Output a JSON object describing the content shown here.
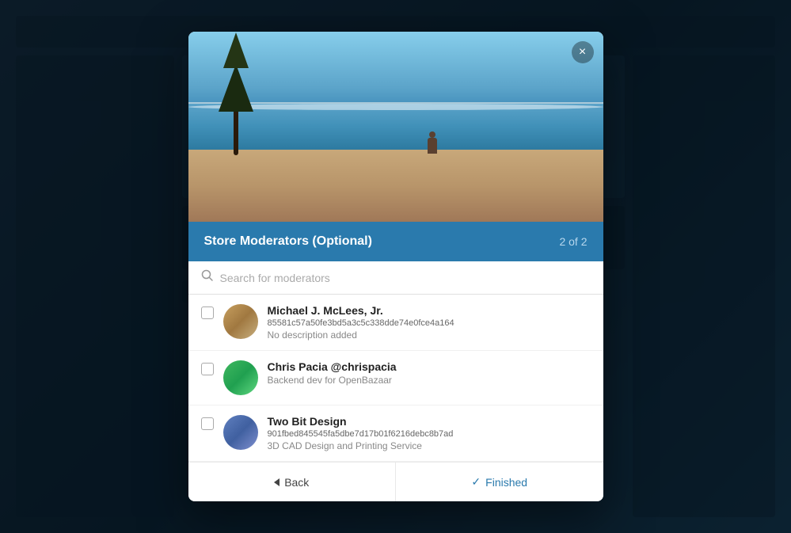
{
  "background": {
    "color": "#1a4a6b"
  },
  "modal": {
    "close_label": "×",
    "hero_alt": "Beach scene with ocean and trees",
    "header": {
      "title": "Store Moderators (Optional)",
      "step": "2 of 2"
    },
    "search": {
      "placeholder": "Search for moderators"
    },
    "users": [
      {
        "name": "Michael J. McLees, Jr.",
        "hash": "85581c57a50fe3bd5a3c5c338dde74e0fce4a164",
        "description": "No description added",
        "avatar_class": "avatar-michael",
        "checked": false
      },
      {
        "name": "Chris Pacia @chrispacia",
        "hash": "",
        "description": "Backend dev for OpenBazaar",
        "avatar_class": "avatar-chris",
        "checked": false
      },
      {
        "name": "Two Bit Design",
        "hash": "901fbed845545fa5dbe7d17b01f6216debc8b7ad",
        "description": "3D CAD Design and Printing Service",
        "avatar_class": "avatar-twobit",
        "checked": false
      }
    ],
    "footer": {
      "back_label": "Back",
      "finished_label": "Finished"
    }
  }
}
